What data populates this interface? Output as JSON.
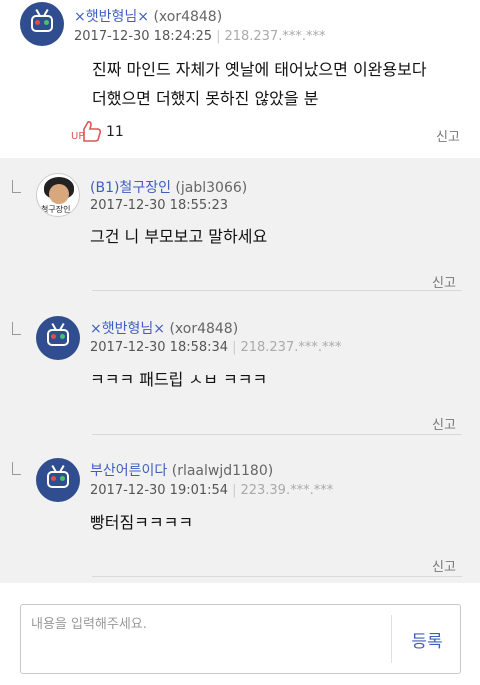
{
  "comments": [
    {
      "nick": "×햇반형님×",
      "uid": "(xor4848)",
      "date": "2017-12-30 18:24:25",
      "ip": "218.237.***.***",
      "lines": [
        "진짜 마인드 자체가 옛날에 태어났으면 이완용보다",
        "더했으면 더했지 못하진 않았을 분"
      ],
      "up_label": "UP",
      "up_count": "11",
      "report": "신고"
    },
    {
      "nick": "(B1)철구장인",
      "uid": "(jabl3066)",
      "date": "2017-12-30 18:55:23",
      "lines": [
        "그건 니 부모보고 말하세요"
      ],
      "avatar_text": "철구장인",
      "report": "신고"
    },
    {
      "nick": "×햇반형님×",
      "uid": "(xor4848)",
      "date": "2017-12-30 18:58:34",
      "ip": "218.237.***.***",
      "lines": [
        "ㅋㅋㅋ 패드립 ㅅㅂ ㅋㅋㅋ"
      ],
      "report": "신고"
    },
    {
      "nick": "부산어른이다",
      "uid": "(rlaalwjd1180)",
      "date": "2017-12-30 19:01:54",
      "ip": "223.39.***.***",
      "lines": [
        "빵터짐ㅋㅋㅋㅋ"
      ],
      "report": "신고"
    }
  ],
  "compose": {
    "placeholder": "내용을 입력해주세요.",
    "submit_label": "등록"
  },
  "colors": {
    "nick": "#3f5fbf",
    "reply_bg": "#f1f1f1",
    "up": "#e05555"
  }
}
